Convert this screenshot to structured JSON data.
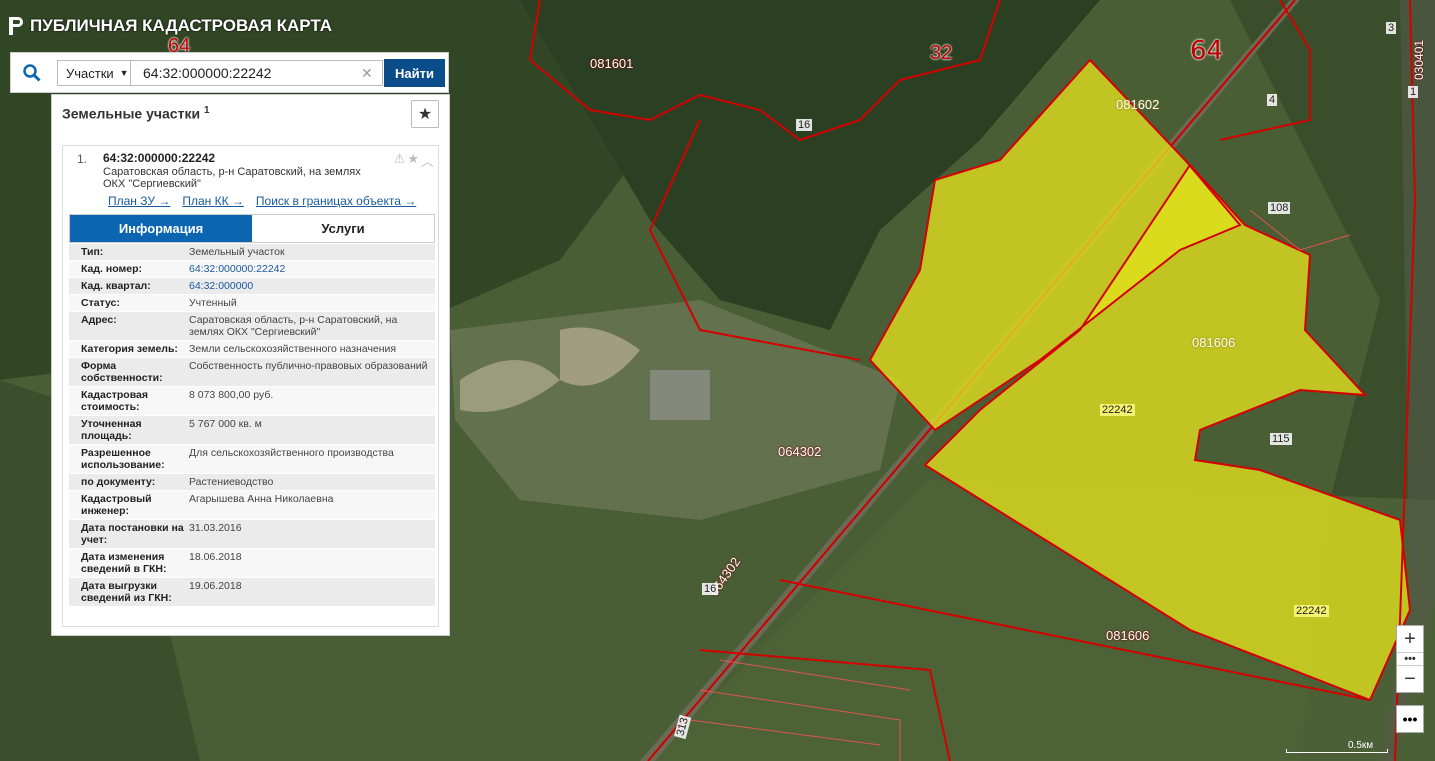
{
  "app": {
    "title": "ПУБЛИЧНАЯ КАДАСТРОВАЯ КАРТА"
  },
  "search": {
    "type_label": "Участки",
    "query": "64:32:000000:22242",
    "find_label": "Найти"
  },
  "panel": {
    "title": "Земельные участки",
    "count": "1",
    "result": {
      "index": "1.",
      "cad_number": "64:32:000000:22242",
      "address": "Саратовская область, р-н Саратовский, на землях ОКХ \"Сергиевский\"",
      "links": [
        "План ЗУ →",
        "План КК →",
        "Поиск в границах объекта →"
      ]
    },
    "tabs": [
      "Информация",
      "Услуги"
    ],
    "info": [
      {
        "k": "Тип:",
        "v": "Земельный участок"
      },
      {
        "k": "Кад. номер:",
        "v": "64:32:000000:22242",
        "link": true
      },
      {
        "k": "Кад. квартал:",
        "v": "64:32:000000",
        "link": true
      },
      {
        "k": "Статус:",
        "v": "Учтенный"
      },
      {
        "k": "Адрес:",
        "v": "Саратовская область, р-н Саратовский, на землях ОКХ \"Сергиевский\""
      },
      {
        "k": "Категория земель:",
        "v": "Земли сельскохозяйственного назначения"
      },
      {
        "k": "Форма собственности:",
        "v": "Собственность публично-правовых образований"
      },
      {
        "k": "Кадастровая стоимость:",
        "v": "8 073 800,00 руб."
      },
      {
        "k": "Уточненная площадь:",
        "v": "5 767 000 кв. м"
      },
      {
        "k": "Разрешенное использование:",
        "v": "Для сельскохозяйственного производства"
      },
      {
        "k": "по документу:",
        "v": "Растениеводство"
      },
      {
        "k": "Кадастровый инженер:",
        "v": "Агарышева Анна Николаевна"
      },
      {
        "k": "Дата постановки на учет:",
        "v": "31.03.2016"
      },
      {
        "k": "Дата изменения сведений в ГКН:",
        "v": "18.06.2018"
      },
      {
        "k": "Дата выгрузки сведений из ГКН:",
        "v": "19.06.2018"
      }
    ]
  },
  "map_labels": {
    "l64a": "64",
    "l64b": "64",
    "l32": "32",
    "q081601": "081601",
    "q081602": "081602",
    "q081606a": "081606",
    "q081606b": "081606",
    "q064302a": "064302",
    "q064302b": "064302",
    "q030401": "030401",
    "n16a": "16",
    "n16b": "16",
    "n4": "4",
    "n3": "3",
    "n1": "1",
    "n108": "108",
    "n115": "115",
    "p22242a": "22242",
    "p22242b": "22242",
    "n313": "313"
  },
  "map_controls": {
    "zoom_in": "+",
    "zoom_out": "−",
    "more": "•••",
    "scale": "0.5км"
  },
  "colors": {
    "accent": "#0b65b0",
    "button": "#0b4d8a",
    "parcel_fill": "#e3e21c",
    "boundary": "#d40000"
  }
}
